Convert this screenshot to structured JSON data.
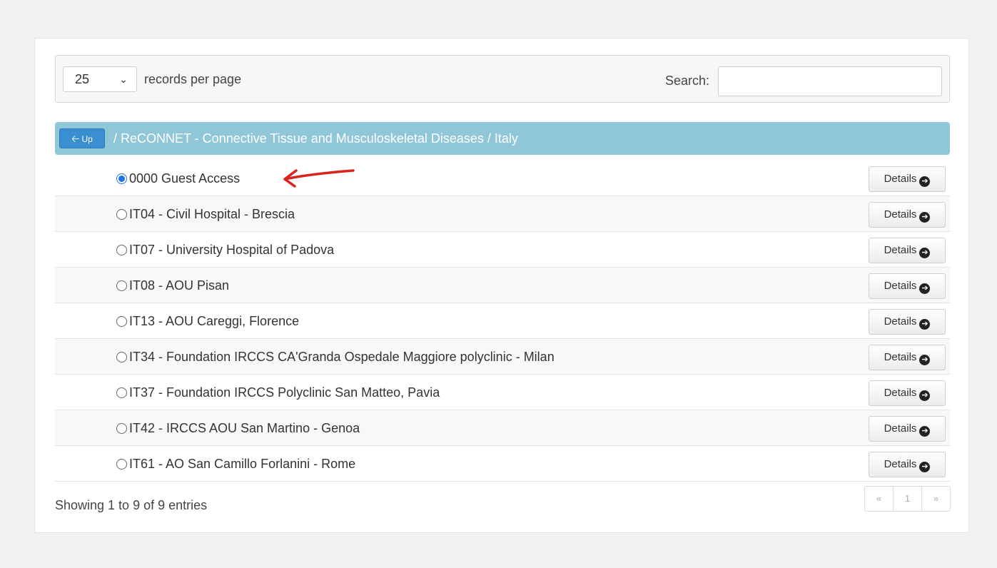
{
  "toolbar": {
    "page_size": "25",
    "records_per_page_label": "records per page",
    "search_label": "Search:",
    "search_value": ""
  },
  "breadcrumb": {
    "up_label": "Up",
    "path": "/ ReCONNET - Connective Tissue and Musculoskeletal Diseases / Italy"
  },
  "rows": [
    {
      "label": "0000 Guest Access",
      "selected": true,
      "details": "Details"
    },
    {
      "label": "IT04 - Civil Hospital - Brescia",
      "selected": false,
      "details": "Details"
    },
    {
      "label": "IT07 - University Hospital of Padova",
      "selected": false,
      "details": "Details"
    },
    {
      "label": "IT08 - AOU Pisan",
      "selected": false,
      "details": "Details"
    },
    {
      "label": "IT13 - AOU Careggi, Florence",
      "selected": false,
      "details": "Details"
    },
    {
      "label": "IT34 - Foundation IRCCS CA'Granda Ospedale Maggiore polyclinic - Milan",
      "selected": false,
      "details": "Details"
    },
    {
      "label": "IT37 - Foundation IRCCS Polyclinic San Matteo, Pavia",
      "selected": false,
      "details": "Details"
    },
    {
      "label": "IT42 - IRCCS AOU San Martino - Genoa",
      "selected": false,
      "details": "Details"
    },
    {
      "label": "IT61 - AO San Camillo Forlanini - Rome",
      "selected": false,
      "details": "Details"
    }
  ],
  "footer": {
    "info": "Showing 1 to 9 of 9 entries"
  },
  "pagination": {
    "prev": "«",
    "page": "1",
    "next": "»"
  },
  "colors": {
    "breadcrumb_bg": "#8fc6d8",
    "up_button_bg": "#3a8fd0",
    "selected_radio": "#1a73e8",
    "annotation_arrow": "#d9231d"
  }
}
